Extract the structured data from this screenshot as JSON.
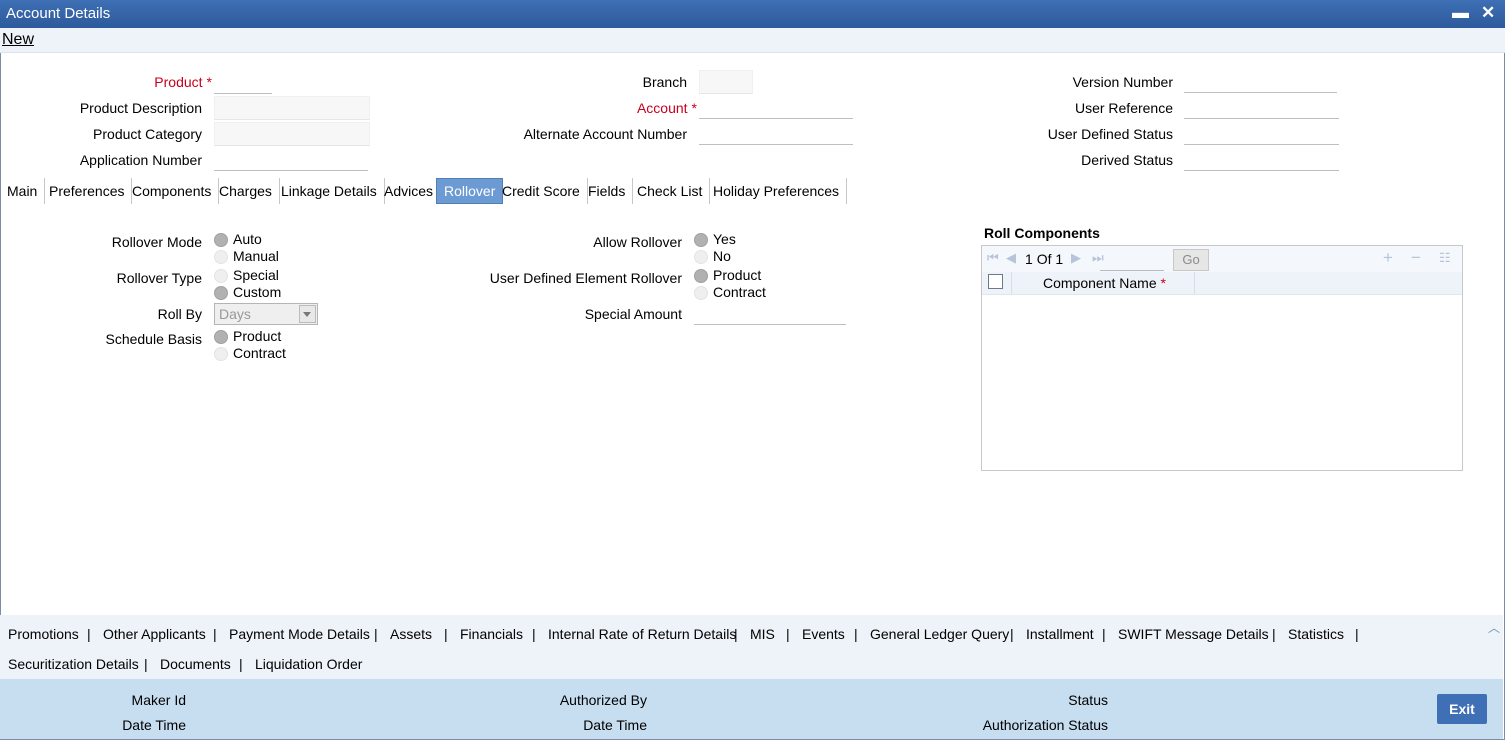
{
  "window": {
    "title": "Account Details",
    "minimize": "▬",
    "close": "✕"
  },
  "toolbar": {
    "new": "New"
  },
  "form": {
    "product": "Product",
    "product_description": "Product Description",
    "product_category": "Product Category",
    "application_number": "Application Number",
    "branch": "Branch",
    "account": "Account",
    "alternate_account_number": "Alternate Account Number",
    "version_number": "Version Number",
    "user_reference": "User Reference",
    "user_defined_status": "User Defined Status",
    "derived_status": "Derived Status",
    "required_marker": "*"
  },
  "tabs": [
    "Main",
    "Preferences",
    "Components",
    "Charges",
    "Linkage Details",
    "Advices",
    "Rollover",
    "Credit Score",
    "Fields",
    "Check List",
    "Holiday Preferences"
  ],
  "active_tab": "Rollover",
  "rollover": {
    "rollover_mode": "Rollover Mode",
    "mode_options": [
      "Auto",
      "Manual"
    ],
    "mode_selected": "Auto",
    "rollover_type": "Rollover Type",
    "type_options": [
      "Special",
      "Custom"
    ],
    "type_selected": "Custom",
    "roll_by": "Roll By",
    "roll_by_value": "Days",
    "schedule_basis": "Schedule Basis",
    "basis_options": [
      "Product",
      "Contract"
    ],
    "basis_selected": "Product",
    "allow_rollover": "Allow Rollover",
    "allow_options": [
      "Yes",
      "No"
    ],
    "allow_selected": "Yes",
    "udf_rollover": "User Defined Element Rollover",
    "udf_options": [
      "Product",
      "Contract"
    ],
    "udf_selected": "Product",
    "special_amount": "Special Amount"
  },
  "roll_components": {
    "title": "Roll Components",
    "page": "1",
    "of": "Of",
    "total": "1",
    "go": "Go",
    "column": "Component Name",
    "required_marker": "*"
  },
  "links_row1": [
    "Promotions",
    "Other Applicants",
    "Payment Mode Details",
    "Assets",
    "Financials",
    "Internal Rate of Return Details",
    "MIS",
    "Events",
    "General Ledger Query",
    "Installment",
    "SWIFT Message Details",
    "Statistics"
  ],
  "links_row2": [
    "Securitization Details",
    "Documents",
    "Liquidation Order"
  ],
  "separator": "|",
  "footer": {
    "maker_id": "Maker Id",
    "date_time": "Date Time",
    "authorized_by": "Authorized By",
    "status": "Status",
    "authorization_status": "Authorization Status",
    "exit": "Exit"
  },
  "colors": {
    "titlebar": "#2c5a9c",
    "active_tab": "#6c9bd3",
    "footer": "#c7ddf0",
    "required": "#c8001e"
  }
}
